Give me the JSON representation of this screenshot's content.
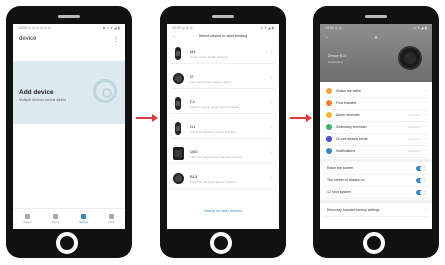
{
  "screen1": {
    "status_left": "10:02 ◎ ◎ ◎ ◎ ◎ ◎",
    "status_right": "▮ ◎ ▾ ◢ ▮",
    "title": "device",
    "menu": "⋮",
    "card_title": "Add device",
    "card_subtitle": "Multiple devices can be added",
    "nav": [
      {
        "label": "Status"
      },
      {
        "label": "Sport"
      },
      {
        "label": "Device"
      },
      {
        "label": "Mine"
      }
    ]
  },
  "screen2": {
    "status_left": "10:02 ◎ ◎ ◎",
    "status_right": "◎ ▾ ◢ ▮",
    "back": "←",
    "title": "Select device to start binding",
    "devices": [
      {
        "name": "M4",
        "desc": "Smart sports health bracelet"
      },
      {
        "name": "I2",
        "desc": "Your best partner wear a watch"
      },
      {
        "name": "F4",
        "desc": "Fashion simple smart sports bracelet"
      },
      {
        "name": "G1",
        "desc": "Full color touching screen bracelet"
      },
      {
        "name": "Q50",
        "desc": "1.54 inch large screen full color screen"
      },
      {
        "name": "B13",
        "desc": "1.54 inch full touch phone bracelet"
      }
    ],
    "link": "Search for other devices"
  },
  "screen3": {
    "status_left": "10:02 ◎ ◎",
    "status_right": "◎ ▾ ◢ ▮",
    "back": "←",
    "gear": "⚙",
    "device_name": "Device B13",
    "device_status": "Connected",
    "rows": [
      {
        "label": "Shake the selfie",
        "value": "",
        "color": "#f0a33a"
      },
      {
        "label": "Find bracelet",
        "value": "",
        "color": "#f27b2e"
      },
      {
        "label": "Alarm reminder",
        "value": "Normal ●",
        "color": "#f3b830"
      },
      {
        "label": "Sedentary reminder",
        "value": "Normal ●",
        "color": "#3db36b"
      },
      {
        "label": "Do not disturb mode",
        "value": "Closed ●",
        "color": "#4a4adc"
      },
      {
        "label": "Notifications",
        "value": "Normal ●",
        "color": "#3a86c8"
      }
    ],
    "toggles": [
      {
        "label": "Raise the screen"
      },
      {
        "label": "The screen is always on"
      },
      {
        "label": "12 hour system"
      }
    ],
    "bottom_row": "Recovery bracelet factory settings"
  },
  "colors": {
    "accent": "#3a86c8",
    "arrow": "#e23a3a",
    "phone": "#111111"
  }
}
